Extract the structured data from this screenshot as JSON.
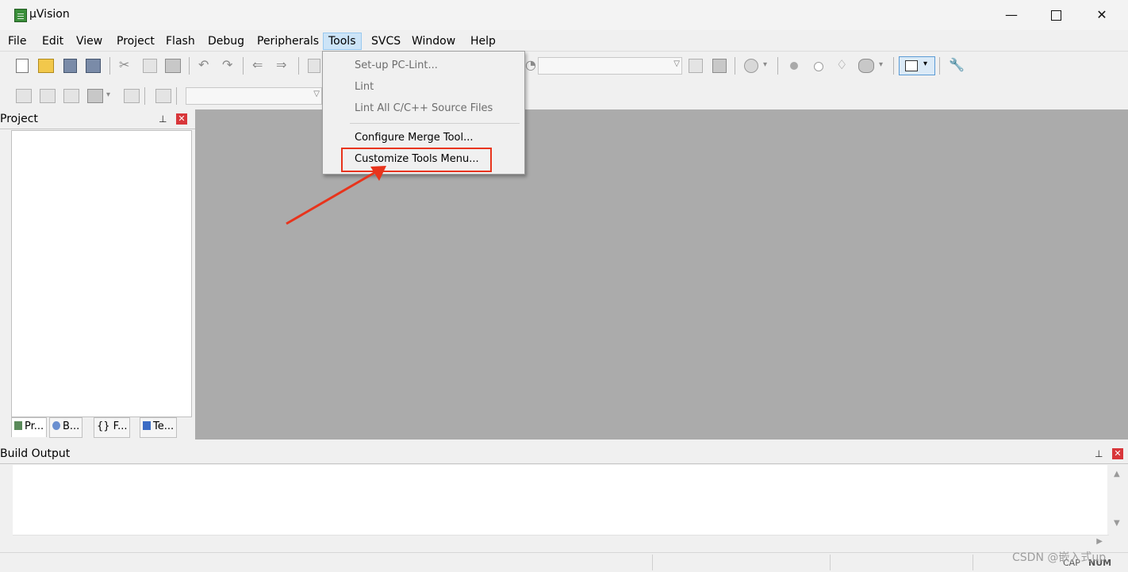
{
  "window": {
    "title": "µVision"
  },
  "menubar": {
    "items": [
      "File",
      "Edit",
      "View",
      "Project",
      "Flash",
      "Debug",
      "Peripherals",
      "Tools",
      "SVCS",
      "Window",
      "Help"
    ],
    "active": "Tools"
  },
  "tools_menu": {
    "items": [
      {
        "label": "Set-up PC-Lint...",
        "enabled": false
      },
      {
        "label": "Lint",
        "enabled": false
      },
      {
        "label": "Lint All C/C++ Source Files",
        "enabled": false
      },
      {
        "label": "Configure Merge Tool...",
        "enabled": true
      },
      {
        "label": "Customize Tools Menu...",
        "enabled": true,
        "highlighted": true
      }
    ]
  },
  "project_panel": {
    "title": "Project",
    "tabs": [
      "Pr...",
      "B...",
      "{} F...",
      "Te..."
    ]
  },
  "build_output": {
    "title": "Build Output"
  },
  "statusbar": {
    "cap": "CAP",
    "num": "NUM"
  },
  "watermark": "CSDN @嵌入式up",
  "colors": {
    "highlight": "#e8341c",
    "editor_bg": "#ababab",
    "active_menu_bg": "#cce4f7"
  },
  "icons": [
    "new-file",
    "open-folder",
    "save",
    "save-all",
    "cut",
    "copy",
    "paste",
    "undo",
    "redo",
    "nav-back",
    "nav-forward",
    "bookmark",
    "find",
    "search",
    "breakpoint",
    "breakpoint-disabled",
    "watch",
    "target",
    "view-window",
    "wrench"
  ]
}
